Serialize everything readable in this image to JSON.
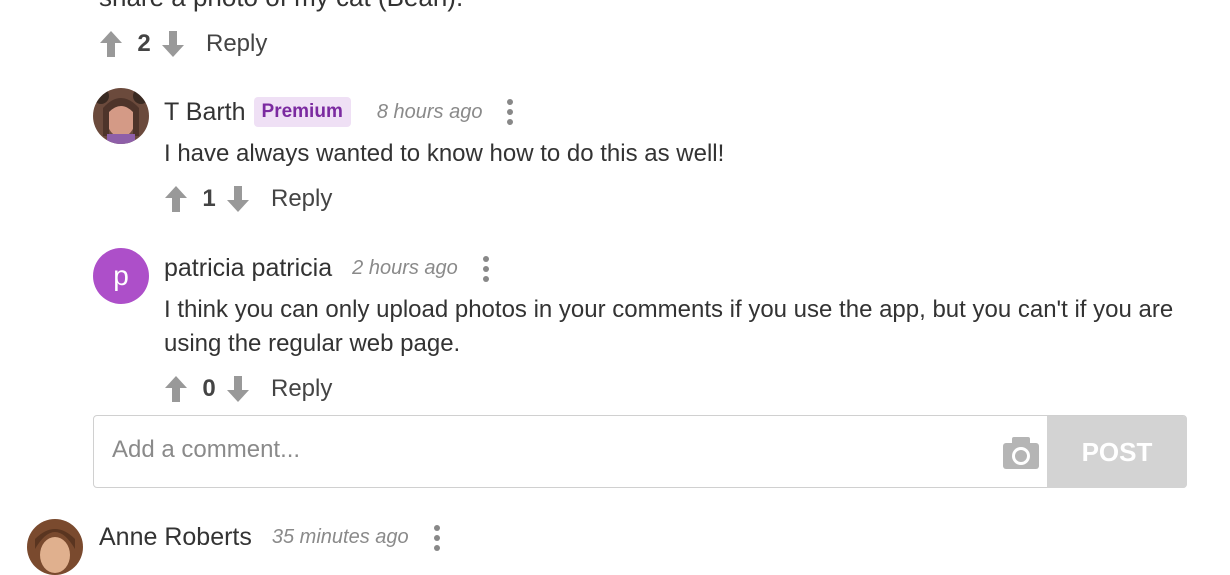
{
  "top_comment": {
    "cut_text": "share a photo of my cat (Bean).",
    "votes": "2",
    "reply_label": "Reply"
  },
  "replies": [
    {
      "author": "T Barth",
      "badge": "Premium",
      "time": "8 hours ago",
      "text": "I have always wanted to know how to do this as well!",
      "votes": "1",
      "reply_label": "Reply"
    },
    {
      "author": "patricia patricia",
      "avatar_letter": "p",
      "time": "2 hours ago",
      "text": "I think you can only upload photos in your comments if you use the app, but you can't if you are using the regular web page.",
      "votes": "0",
      "reply_label": "Reply"
    }
  ],
  "comment_input": {
    "placeholder": "Add a comment...",
    "post_label": "POST"
  },
  "next_comment": {
    "author": "Anne Roberts",
    "time": "35 minutes ago"
  },
  "colors": {
    "premium_badge_bg": "#efe0f5",
    "premium_badge_text": "#7b2aa0",
    "avatar_p": "#ad4fc9",
    "post_button": "#d3d3d3"
  },
  "icons": [
    "upvote-icon",
    "downvote-icon",
    "more-options-icon",
    "camera-icon"
  ]
}
